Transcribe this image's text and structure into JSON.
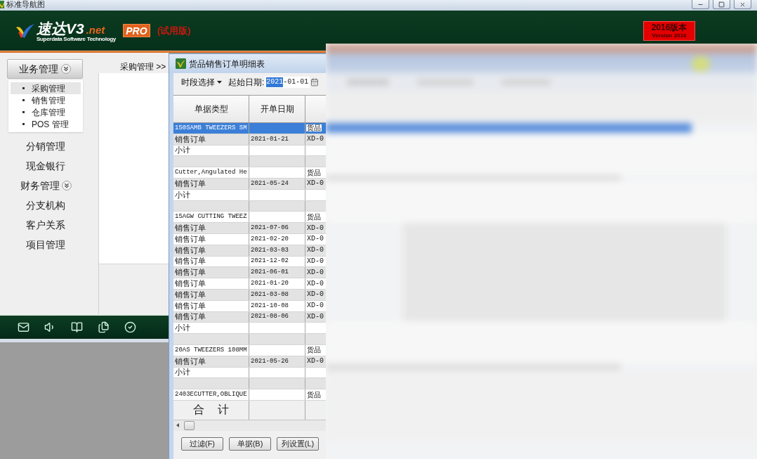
{
  "window": {
    "title": "标准导航图"
  },
  "header": {
    "logo": {
      "name": "速达V3",
      "suffix": ".net",
      "tagline": "Superdata Software Technology"
    },
    "edition": "PRO",
    "trial_label": "(试用版)",
    "version_badge": {
      "title": "2016版本",
      "subtitle": "Version 2016"
    }
  },
  "sidebar": {
    "items": [
      {
        "label": "业务管理",
        "kind": "group",
        "expanded": true,
        "children": [
          {
            "label": "采购管理",
            "selected": true
          },
          {
            "label": "销售管理",
            "selected": false
          },
          {
            "label": "仓库管理",
            "selected": false
          },
          {
            "label": "POS 管理",
            "selected": false
          }
        ]
      },
      {
        "label": "分销管理",
        "kind": "link",
        "expanded": false
      },
      {
        "label": "现金银行",
        "kind": "link",
        "expanded": false
      },
      {
        "label": "财务管理",
        "kind": "group",
        "expanded": false
      },
      {
        "label": "分支机构",
        "kind": "link",
        "expanded": false
      },
      {
        "label": "客户关系",
        "kind": "link",
        "expanded": false
      },
      {
        "label": "项目管理",
        "kind": "link",
        "expanded": false
      }
    ]
  },
  "breadcrumb": "采购管理 >>",
  "dialog": {
    "title": "货品销售订单明细表",
    "toolbar": {
      "period_menu": "时段选择",
      "start_date": {
        "label": "起始日期:",
        "value_parts": [
          {
            "text": "2021",
            "selected": true
          },
          {
            "text": "-01-01",
            "selected": false
          }
        ]
      }
    },
    "table": {
      "columns": [
        "单据类型",
        "开单日期"
      ],
      "rows": [
        {
          "kind": "item",
          "selected": true,
          "doc_type": "150SAMB TWEEZERS SM",
          "column_3": "货品"
        },
        {
          "kind": "order",
          "selected": false,
          "doc_type": "销售订单",
          "date": "2021-01-21",
          "column_3": "XD-0"
        },
        {
          "kind": "subtotal",
          "selected": false,
          "doc_type": "小计"
        },
        {
          "kind": "spacer",
          "selected": false
        },
        {
          "kind": "item",
          "selected": false,
          "doc_type": "Cutter,Angulated He",
          "column_3": "货品"
        },
        {
          "kind": "order",
          "selected": false,
          "doc_type": "销售订单",
          "date": "2021-05-24",
          "column_3": "XD-0"
        },
        {
          "kind": "subtotal",
          "selected": false,
          "doc_type": "小计"
        },
        {
          "kind": "spacer",
          "selected": false
        },
        {
          "kind": "item",
          "selected": false,
          "doc_type": "15AGW CUTTING TWEEZ",
          "column_3": "货品"
        },
        {
          "kind": "order",
          "selected": false,
          "doc_type": "销售订单",
          "date": "2021-07-06",
          "column_3": "XD-0"
        },
        {
          "kind": "order",
          "selected": false,
          "doc_type": "销售订单",
          "date": "2021-02-20",
          "column_3": "XD-0"
        },
        {
          "kind": "order",
          "selected": false,
          "doc_type": "销售订单",
          "date": "2021-03-03",
          "column_3": "XD-0"
        },
        {
          "kind": "order",
          "selected": false,
          "doc_type": "销售订单",
          "date": "2021-12-02",
          "column_3": "XD-0"
        },
        {
          "kind": "order",
          "selected": false,
          "doc_type": "销售订单",
          "date": "2021-06-01",
          "column_3": "XD-0"
        },
        {
          "kind": "order",
          "selected": false,
          "doc_type": "销售订单",
          "date": "2021-01-20",
          "column_3": "XD-0"
        },
        {
          "kind": "order",
          "selected": false,
          "doc_type": "销售订单",
          "date": "2021-03-08",
          "column_3": "XD-0"
        },
        {
          "kind": "order",
          "selected": false,
          "doc_type": "销售订单",
          "date": "2021-10-08",
          "column_3": "XD-0"
        },
        {
          "kind": "order",
          "selected": false,
          "doc_type": "销售订单",
          "date": "2021-08-06",
          "column_3": "XD-0"
        },
        {
          "kind": "subtotal",
          "selected": false,
          "doc_type": "小计"
        },
        {
          "kind": "spacer",
          "selected": false
        },
        {
          "kind": "item",
          "selected": false,
          "doc_type": "20AS TWEEZERS 108MM",
          "column_3": "货品"
        },
        {
          "kind": "order",
          "selected": false,
          "doc_type": "销售订单",
          "date": "2021-05-26",
          "column_3": "XD-0"
        },
        {
          "kind": "subtotal",
          "selected": false,
          "doc_type": "小计"
        },
        {
          "kind": "spacer",
          "selected": false
        },
        {
          "kind": "item",
          "selected": false,
          "doc_type": "2403ECUTTER,OBLIQUE",
          "column_3": "货品"
        }
      ],
      "total_label": "合 计"
    },
    "buttons": [
      "过滤(F)",
      "单据(B)",
      "列设置(L)"
    ]
  }
}
